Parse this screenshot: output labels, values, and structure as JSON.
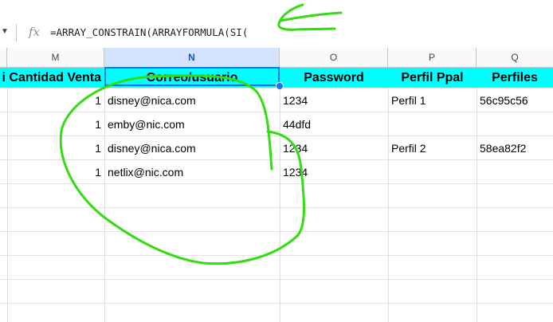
{
  "formula_bar": {
    "caret_icon": "caret-down-icon",
    "fx_label": "fx",
    "formula": "=ARRAY_CONSTRAIN(ARRAYFORMULA(SI("
  },
  "columns": [
    "M",
    "N",
    "O",
    "P",
    "Q"
  ],
  "selected_column": "N",
  "header_row": {
    "m": "i Cantidad Venta",
    "n": "Correo/usuario",
    "o": "Password",
    "p": "Perfil Ppal",
    "q": "Perfiles"
  },
  "rows": [
    {
      "cantidad": "1",
      "correo": "disney@nica.com",
      "password": "1234",
      "perfil_ppal": "Perfil 1",
      "perfiles": "56c95c56"
    },
    {
      "cantidad": "1",
      "correo": "emby@nic.com",
      "password": "44dfd",
      "perfil_ppal": "",
      "perfiles": ""
    },
    {
      "cantidad": "1",
      "correo": "disney@nica.com",
      "password": "1234",
      "perfil_ppal": "Perfil 2",
      "perfiles": "58ea82f2"
    },
    {
      "cantidad": "1",
      "correo": "netlix@nic.com",
      "password": "1234",
      "perfil_ppal": "",
      "perfiles": ""
    }
  ],
  "colors": {
    "header_fill": "#00ffff",
    "selection": "#1a73e8",
    "annotation": "#33dd11"
  }
}
